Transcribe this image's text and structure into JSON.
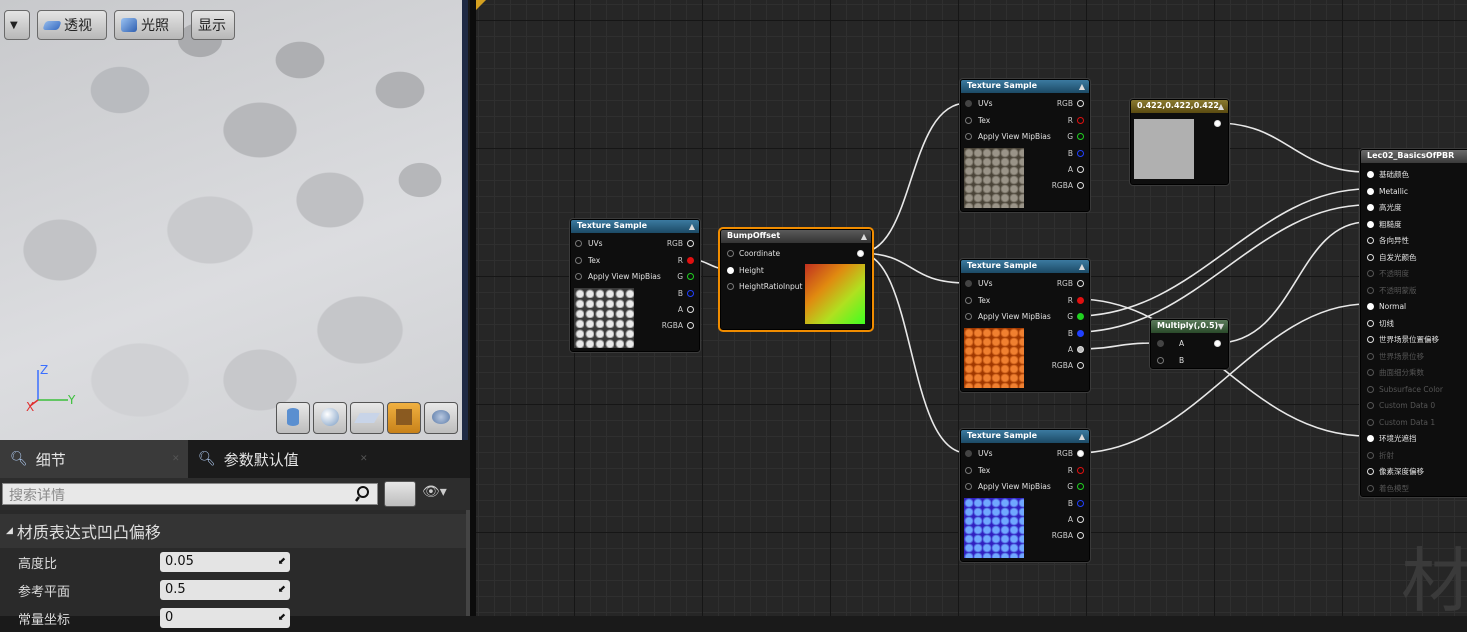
{
  "viewport": {
    "menu_btn": "▼",
    "perspective": "透视",
    "lighting": "光照",
    "show": "显示",
    "axis_z": "Z",
    "axis_y": "Y",
    "axis_x": "X"
  },
  "details": {
    "tab1": "细节",
    "tab2": "参数默认值",
    "search_placeholder": "搜索详情",
    "section_title": "材质表达式凹凸偏移",
    "props": [
      {
        "label": "高度比",
        "value": "0.05"
      },
      {
        "label": "参考平面",
        "value": "0.5"
      },
      {
        "label": "常量坐标",
        "value": "0"
      }
    ]
  },
  "graph": {
    "ts_header": "Texture Sample",
    "uvs": "UVs",
    "tex": "Tex",
    "mip": "Apply View MipBias",
    "rgb": "RGB",
    "r": "R",
    "g": "G",
    "b": "B",
    "a": "A",
    "rgba": "RGBA",
    "bump_header": "BumpOffset",
    "coordinate": "Coordinate",
    "height": "Height",
    "height_ratio_input": "HeightRatioInput",
    "const_header": "0.422,0.422,0.422",
    "multiply_header": "Multiply(,0.5)",
    "mult_a": "A",
    "mult_b": "B",
    "material_header": "Lec02_BasicsOfPBR",
    "material_inputs": [
      "基础颜色",
      "Metallic",
      "高光度",
      "粗糙度",
      "各向异性",
      "自发光颜色",
      "不透明度",
      "不透明蒙版",
      "Normal",
      "切线",
      "世界场景位置偏移",
      "世界场景位移",
      "曲面细分乘数",
      "Subsurface Color",
      "Custom Data 0",
      "Custom Data 1",
      "环境光遮挡",
      "折射",
      "像素深度偏移",
      "着色模型"
    ],
    "material_enabled": [
      true,
      true,
      true,
      true,
      true,
      true,
      false,
      false,
      true,
      true,
      true,
      false,
      false,
      false,
      false,
      false,
      true,
      false,
      true,
      false
    ],
    "watermark": "材"
  }
}
